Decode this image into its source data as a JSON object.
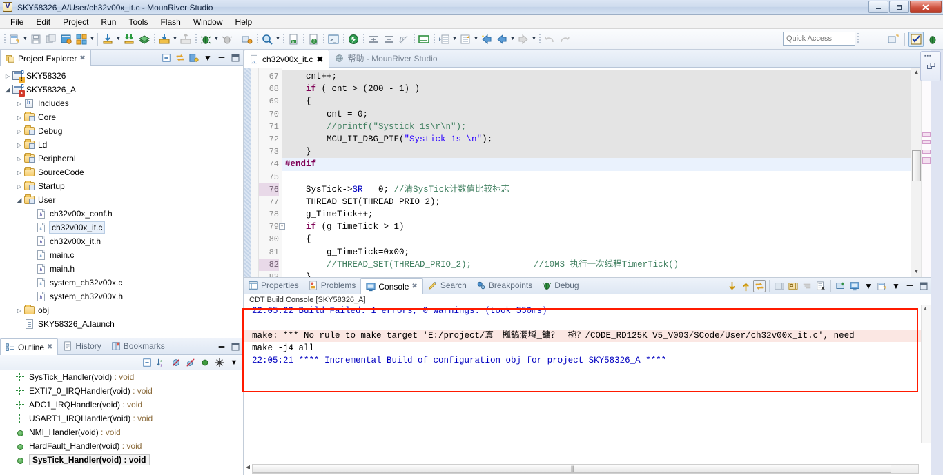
{
  "window": {
    "title": "SKY58326_A/User/ch32v00x_it.c - MounRiver Studio",
    "app_icon": "mounriver-logo-icon",
    "minimize": "—",
    "maximize": "□",
    "close": "✕"
  },
  "menu": {
    "items": [
      {
        "label": "File"
      },
      {
        "label": "Edit"
      },
      {
        "label": "Project"
      },
      {
        "label": "Run"
      },
      {
        "label": "Tools"
      },
      {
        "label": "Flash"
      },
      {
        "label": "Window"
      },
      {
        "label": "Help"
      }
    ]
  },
  "toolbar": {
    "quick_access_placeholder": "Quick Access",
    "quick_access_value": ""
  },
  "project_explorer": {
    "tab_label": "Project Explorer",
    "tree": [
      {
        "label": "SKY58326",
        "indent": 0,
        "twisty": "collapsed",
        "icon": "c-project-icon",
        "badge": "warn",
        "selected": false
      },
      {
        "label": "SKY58326_A",
        "indent": 0,
        "twisty": "expanded",
        "icon": "c-project-icon",
        "badge": "err",
        "selected": false
      },
      {
        "label": "Includes",
        "indent": 1,
        "twisty": "collapsed",
        "icon": "includes-icon",
        "badge": "",
        "selected": false
      },
      {
        "label": "Core",
        "indent": 1,
        "twisty": "collapsed",
        "icon": "source-folder-icon",
        "badge": "",
        "selected": false
      },
      {
        "label": "Debug",
        "indent": 1,
        "twisty": "collapsed",
        "icon": "source-folder-icon",
        "badge": "",
        "selected": false
      },
      {
        "label": "Ld",
        "indent": 1,
        "twisty": "collapsed",
        "icon": "source-folder-icon",
        "badge": "",
        "selected": false
      },
      {
        "label": "Peripheral",
        "indent": 1,
        "twisty": "collapsed",
        "icon": "source-folder-icon",
        "badge": "",
        "selected": false
      },
      {
        "label": "SourceCode",
        "indent": 1,
        "twisty": "collapsed",
        "icon": "folder-icon",
        "badge": "",
        "selected": false
      },
      {
        "label": "Startup",
        "indent": 1,
        "twisty": "collapsed",
        "icon": "source-folder-icon",
        "badge": "",
        "selected": false
      },
      {
        "label": "User",
        "indent": 1,
        "twisty": "expanded",
        "icon": "source-folder-icon",
        "badge": "",
        "selected": false
      },
      {
        "label": "ch32v00x_conf.h",
        "indent": 2,
        "twisty": "none",
        "icon": "h-file-icon",
        "badge": "",
        "selected": false
      },
      {
        "label": "ch32v00x_it.c",
        "indent": 2,
        "twisty": "none",
        "icon": "c-file-icon",
        "badge": "",
        "selected": true
      },
      {
        "label": "ch32v00x_it.h",
        "indent": 2,
        "twisty": "none",
        "icon": "h-file-icon",
        "badge": "",
        "selected": false
      },
      {
        "label": "main.c",
        "indent": 2,
        "twisty": "none",
        "icon": "c-file-icon",
        "badge": "",
        "selected": false
      },
      {
        "label": "main.h",
        "indent": 2,
        "twisty": "none",
        "icon": "h-file-icon",
        "badge": "",
        "selected": false
      },
      {
        "label": "system_ch32v00x.c",
        "indent": 2,
        "twisty": "none",
        "icon": "c-file-icon",
        "badge": "",
        "selected": false
      },
      {
        "label": "system_ch32v00x.h",
        "indent": 2,
        "twisty": "none",
        "icon": "h-file-icon",
        "badge": "",
        "selected": false
      },
      {
        "label": "obj",
        "indent": 1,
        "twisty": "collapsed",
        "icon": "folder-icon",
        "badge": "",
        "selected": false
      },
      {
        "label": "SKY58326_A.launch",
        "indent": 1,
        "twisty": "none",
        "icon": "launch-file-icon",
        "badge": "",
        "selected": false
      }
    ]
  },
  "outline": {
    "tabs": [
      {
        "label": "Outline",
        "icon": "outline-icon",
        "active": true,
        "closable": true
      },
      {
        "label": "History",
        "icon": "history-icon",
        "active": false,
        "closable": false
      },
      {
        "label": "Bookmarks",
        "icon": "bookmarks-icon",
        "active": false,
        "closable": false
      }
    ],
    "items": [
      {
        "name": "SysTick_Handler(void)",
        "type": " : void",
        "icon": "cross-marker-icon",
        "selected": false
      },
      {
        "name": "EXTI7_0_IRQHandler(void)",
        "type": " : void",
        "icon": "cross-marker-icon",
        "selected": false
      },
      {
        "name": "ADC1_IRQHandler(void)",
        "type": " : void",
        "icon": "cross-marker-icon",
        "selected": false
      },
      {
        "name": "USART1_IRQHandler(void)",
        "type": " : void",
        "icon": "cross-marker-icon",
        "selected": false
      },
      {
        "name": "NMI_Handler(void)",
        "type": " : void",
        "icon": "green-dot-icon",
        "selected": false
      },
      {
        "name": "HardFault_Handler(void)",
        "type": " : void",
        "icon": "green-dot-icon",
        "selected": false
      },
      {
        "name": "SysTick_Handler(void) : void",
        "type": "",
        "icon": "green-dot-icon",
        "selected": true
      }
    ]
  },
  "editor": {
    "tabs": [
      {
        "label": "ch32v00x_it.c",
        "icon": "c-file-icon",
        "active": true,
        "closable": true
      },
      {
        "label": "帮助  -  MounRiver Studio",
        "icon": "help-globe-icon",
        "active": false,
        "closable": false
      }
    ],
    "first_line": 67,
    "lines": [
      {
        "num": "67",
        "shade": "grey",
        "fold": "",
        "text": "    cnt++;"
      },
      {
        "num": "68",
        "shade": "grey",
        "fold": "",
        "text": "    if ( cnt > (200 - 1) )"
      },
      {
        "num": "69",
        "shade": "grey",
        "fold": "",
        "text": "    {"
      },
      {
        "num": "70",
        "shade": "grey",
        "fold": "",
        "text": "        cnt = 0;"
      },
      {
        "num": "71",
        "shade": "grey",
        "fold": "",
        "text": "        //printf(\"Systick 1s\\r\\n\");"
      },
      {
        "num": "72",
        "shade": "grey",
        "fold": "",
        "text": "        MCU_IT_DBG_PTF(\"Systick 1s \\n\");"
      },
      {
        "num": "73",
        "shade": "grey",
        "fold": "",
        "text": "    }"
      },
      {
        "num": "74",
        "shade": "blue",
        "fold": "",
        "text": "#endif"
      },
      {
        "num": "75",
        "shade": "",
        "fold": "",
        "text": ""
      },
      {
        "num": "76",
        "shade": "hl",
        "fold": "",
        "text": "    SysTick->SR = 0; //清SysTick计数值比较标志"
      },
      {
        "num": "77",
        "shade": "",
        "fold": "",
        "text": "    THREAD_SET(THREAD_PRIO_2);"
      },
      {
        "num": "78",
        "shade": "",
        "fold": "",
        "text": "    g_TimeTick++;"
      },
      {
        "num": "79",
        "shade": "",
        "fold": "-",
        "text": "    if (g_TimeTick > 1)"
      },
      {
        "num": "80",
        "shade": "",
        "fold": "",
        "text": "    {"
      },
      {
        "num": "81",
        "shade": "",
        "fold": "",
        "text": "        g_TimeTick=0x00;"
      },
      {
        "num": "82",
        "shade": "hl",
        "fold": "",
        "text": "        //THREAD_SET(THREAD_PRIO_2);            //10MS 执行一次线程TimerTick()"
      },
      {
        "num": "83",
        "shade": "",
        "fold": "",
        "text": "    }"
      }
    ]
  },
  "console": {
    "tabs": [
      {
        "label": "Properties",
        "icon": "properties-icon",
        "active": false,
        "closable": false
      },
      {
        "label": "Problems",
        "icon": "problems-icon",
        "active": false,
        "closable": false
      },
      {
        "label": "Console",
        "icon": "console-icon",
        "active": true,
        "closable": true
      },
      {
        "label": "Search",
        "icon": "search-icon",
        "active": false,
        "closable": false
      },
      {
        "label": "Breakpoints",
        "icon": "breakpoints-icon",
        "active": false,
        "closable": false
      },
      {
        "label": "Debug",
        "icon": "debug-bug-icon",
        "active": false,
        "closable": false
      }
    ],
    "title": "CDT Build Console [SKY58326_A]",
    "lines": [
      {
        "text": "22:05:21 **** Incremental Build of configuration obj for project SKY58326_A ****",
        "style": "blue",
        "error": false
      },
      {
        "text": "make -j4 all",
        "style": "black",
        "error": false
      },
      {
        "text": "make: *** No rule to make target 'E:/project/寰　槬鎬濶埒_鏞？　椀？/CODE_RD125K V5_V003/SCode/User/ch32v00x_it.c', need",
        "style": "black",
        "error": true
      },
      {
        "text": "",
        "style": "black",
        "error": false
      },
      {
        "text": "22:05:22 Build Failed. 1 errors, 0 warnings. (took 550ms)",
        "style": "blue",
        "error": false
      }
    ],
    "highlight_color": "#ff1a00"
  },
  "colors": {
    "accent_blue": "#0000c0",
    "error_bg": "#fbe7e3",
    "keyword": "#7f0055",
    "string": "#2a00ff",
    "comment": "#3f7f5f",
    "titlebar_close": "#cf5340"
  }
}
